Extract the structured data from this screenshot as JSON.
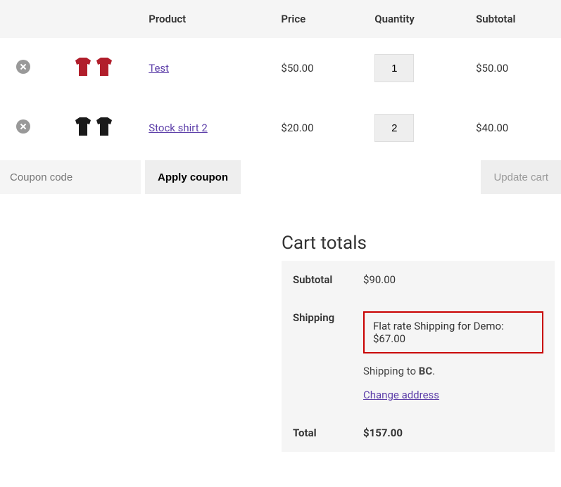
{
  "table": {
    "headers": {
      "product": "Product",
      "price": "Price",
      "quantity": "Quantity",
      "subtotal": "Subtotal"
    },
    "items": [
      {
        "name": "Test",
        "price": "$50.00",
        "qty": "1",
        "subtotal": "$50.00",
        "color": "#b11e2b"
      },
      {
        "name": "Stock shirt 2",
        "price": "$20.00",
        "qty": "2",
        "subtotal": "$40.00",
        "color": "#1a1a1a"
      }
    ]
  },
  "coupon": {
    "placeholder": "Coupon code",
    "apply_label": "Apply coupon"
  },
  "update_label": "Update cart",
  "totals": {
    "title": "Cart totals",
    "subtotal_label": "Subtotal",
    "subtotal_value": "$90.00",
    "shipping_label": "Shipping",
    "shipping_method": "Flat rate Shipping for Demo: $67.00",
    "shipping_to_prefix": "Shipping to ",
    "shipping_to_dest": "BC",
    "shipping_to_suffix": ".",
    "change_address": "Change address",
    "total_label": "Total",
    "total_value": "$157.00"
  }
}
